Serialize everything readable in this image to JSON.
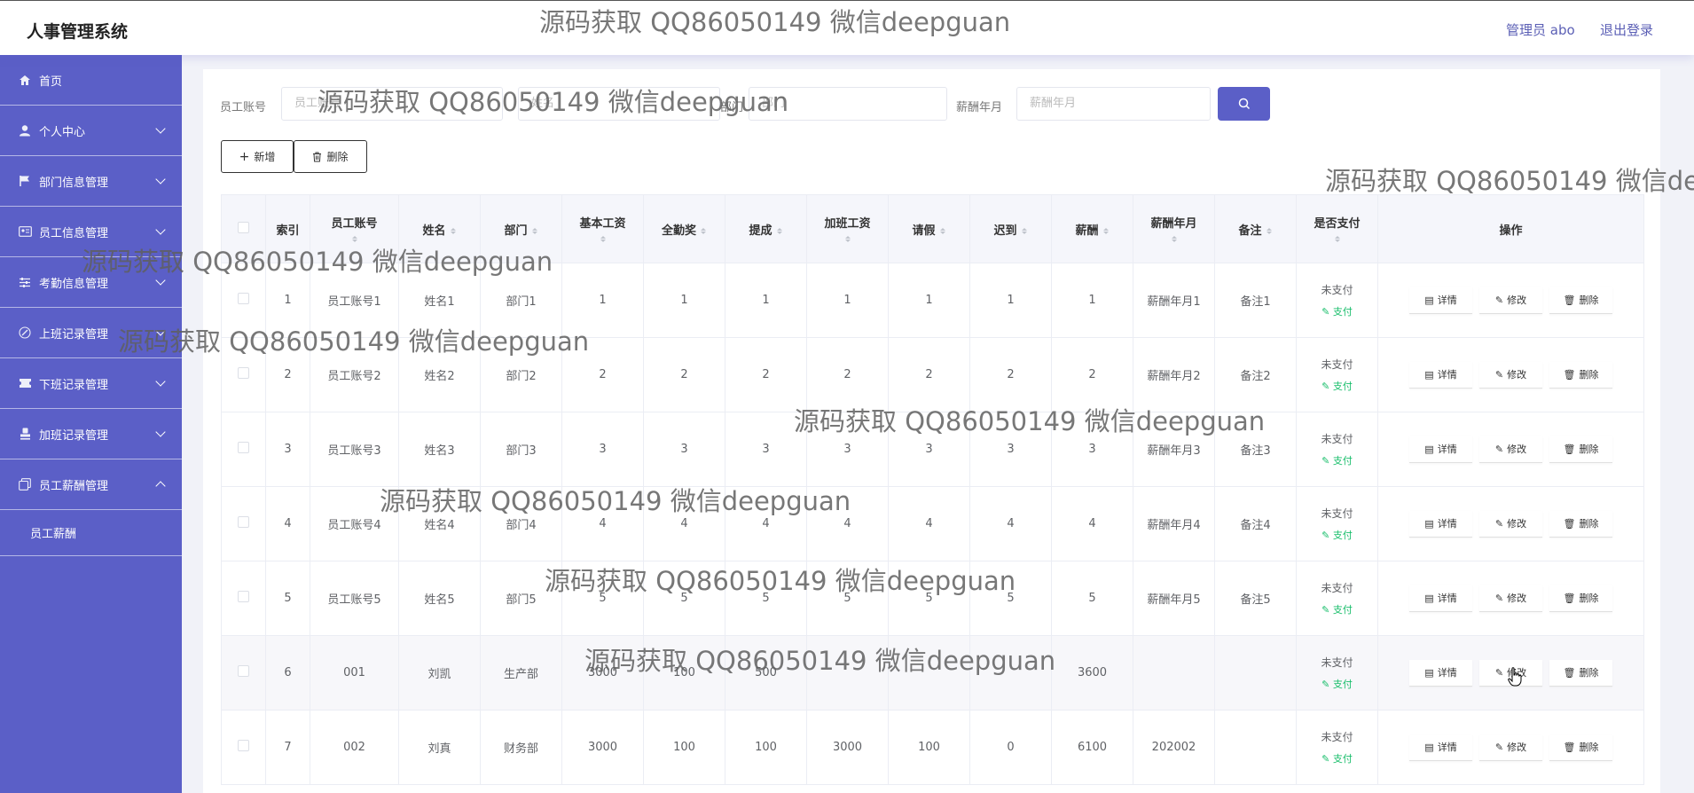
{
  "app": {
    "title": "人事管理系统",
    "user": "管理员 abo",
    "logout": "退出登录"
  },
  "sidebar": {
    "items": [
      {
        "label": "首页",
        "icon": "home-icon"
      },
      {
        "label": "个人中心",
        "icon": "user-icon"
      },
      {
        "label": "部门信息管理",
        "icon": "flag-icon"
      },
      {
        "label": "员工信息管理",
        "icon": "id-card-icon"
      },
      {
        "label": "考勤信息管理",
        "icon": "sliders-icon"
      },
      {
        "label": "上班记录管理",
        "icon": "pen-icon"
      },
      {
        "label": "下班记录管理",
        "icon": "ticket-icon"
      },
      {
        "label": "加班记录管理",
        "icon": "stamp-icon"
      },
      {
        "label": "员工薪酬管理",
        "icon": "copy-icon"
      }
    ],
    "subitem": "员工薪酬"
  },
  "search": {
    "account_label": "员工账号",
    "account_placeholder": "员工账号",
    "name_label": "姓名",
    "name_placeholder": "姓名",
    "dept_label": "部门",
    "dept_placeholder": "部门",
    "month_label": "薪酬年月",
    "month_placeholder": "薪酬年月"
  },
  "toolbar": {
    "add": "新增",
    "delete": "删除"
  },
  "table": {
    "columns": [
      "索引",
      "员工账号",
      "姓名",
      "部门",
      "基本工资",
      "全勤奖",
      "提成",
      "加班工资",
      "请假",
      "迟到",
      "薪酬",
      "薪酬年月",
      "备注",
      "是否支付",
      "操作"
    ],
    "rows": [
      [
        "1",
        "员工账号1",
        "姓名1",
        "部门1",
        "1",
        "1",
        "1",
        "1",
        "1",
        "1",
        "1",
        "薪酬年月1",
        "备注1"
      ],
      [
        "2",
        "员工账号2",
        "姓名2",
        "部门2",
        "2",
        "2",
        "2",
        "2",
        "2",
        "2",
        "2",
        "薪酬年月2",
        "备注2"
      ],
      [
        "3",
        "员工账号3",
        "姓名3",
        "部门3",
        "3",
        "3",
        "3",
        "3",
        "3",
        "3",
        "3",
        "薪酬年月3",
        "备注3"
      ],
      [
        "4",
        "员工账号4",
        "姓名4",
        "部门4",
        "4",
        "4",
        "4",
        "4",
        "4",
        "4",
        "4",
        "薪酬年月4",
        "备注4"
      ],
      [
        "5",
        "员工账号5",
        "姓名5",
        "部门5",
        "5",
        "5",
        "5",
        "5",
        "5",
        "5",
        "5",
        "薪酬年月5",
        "备注5"
      ],
      [
        "6",
        "001",
        "刘凯",
        "生产部",
        "3000",
        "100",
        "500",
        "",
        "",
        "",
        "3600",
        "",
        ""
      ],
      [
        "7",
        "002",
        "刘真",
        "财务部",
        "3000",
        "100",
        "100",
        "3000",
        "100",
        "0",
        "6100",
        "202002",
        ""
      ]
    ],
    "status_unpaid": "未支付",
    "pay_link": "支付",
    "op_detail": "详情",
    "op_edit": "修改",
    "op_delete": "删除"
  },
  "watermark": "源码获取 QQ86050149 微信deepguan",
  "colors": {
    "primary": "#5b5fc7",
    "pay": "#19be6b"
  }
}
